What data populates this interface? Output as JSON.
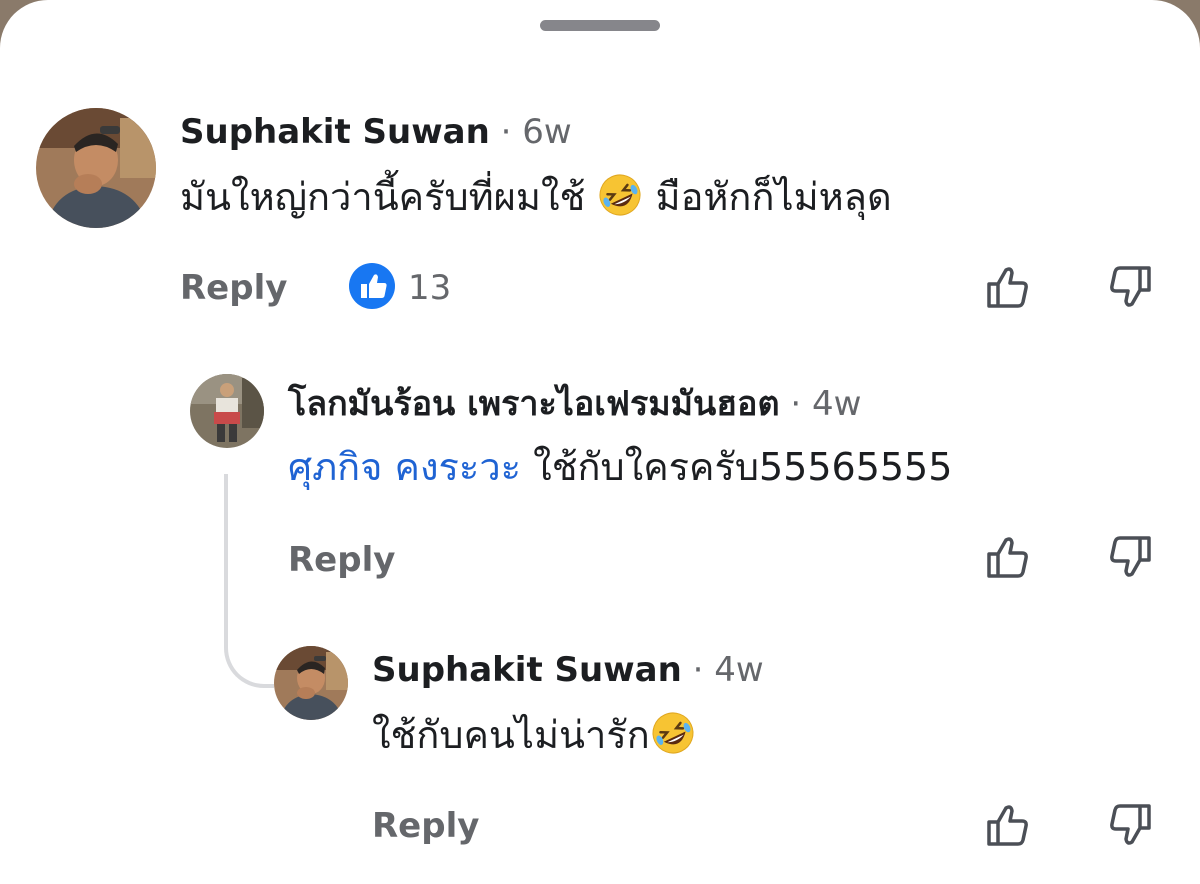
{
  "comments": [
    {
      "author": "Suphakit Suwan",
      "separator": "·",
      "time": "6w",
      "text_before": "มันใหญ่กว่านี้ครับที่ผมใช้",
      "emoji": "rolling-on-floor-laughing",
      "text_after": "มือหักก็ไม่หลุด",
      "reply_label": "Reply",
      "reaction": "like",
      "reaction_count": "13"
    },
    {
      "author": "โลกมันร้อน เพราะไอเฟรมมันฮอต",
      "separator": "·",
      "time": "4w",
      "mention": "ศุภกิจ คงระวะ",
      "text": "ใช้กับใครครับ55565555",
      "reply_label": "Reply"
    },
    {
      "author": "Suphakit Suwan",
      "separator": "·",
      "time": "4w",
      "text": "ใช้กับคนไม่น่ารัก",
      "emoji": "rolling-on-floor-laughing",
      "reply_label": "Reply"
    }
  ],
  "colors": {
    "accent_blue": "#1f63d3",
    "like_blue": "#1877f2",
    "secondary_text": "#65676b",
    "thread_line": "#d9dadd"
  }
}
